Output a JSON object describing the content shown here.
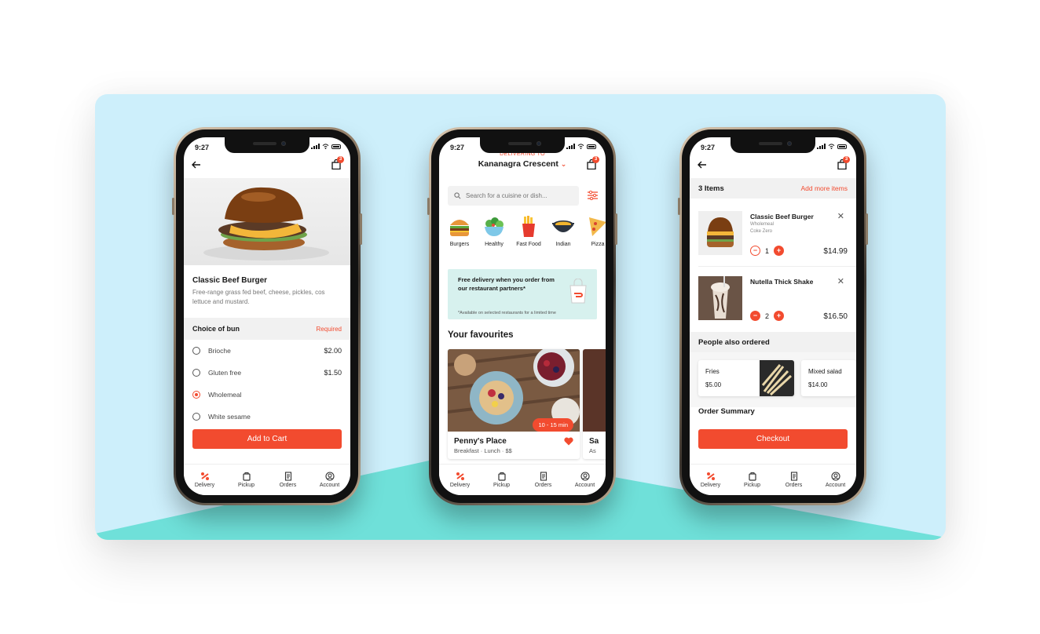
{
  "status_time": "9:27",
  "cart_count": "3",
  "tabs": [
    {
      "label": "Delivery",
      "icon": "delivery-icon"
    },
    {
      "label": "Pickup",
      "icon": "pickup-bag-icon"
    },
    {
      "label": "Orders",
      "icon": "receipt-icon"
    },
    {
      "label": "Account",
      "icon": "account-icon"
    }
  ],
  "colors": {
    "accent": "#f24b2f",
    "background": "#cdeffb",
    "floor": "#6fe0d9",
    "promo": "#d7f1ee"
  },
  "product": {
    "title": "Classic Beef Burger",
    "description": "Free-range grass fed beef, cheese, pickles, cos lettuce and mustard.",
    "section_title": "Choice of bun",
    "section_required": "Required",
    "options": [
      {
        "label": "Brioche",
        "price": "$2.00",
        "selected": false
      },
      {
        "label": "Gluten free",
        "price": "$1.50",
        "selected": false
      },
      {
        "label": "Wholemeal",
        "price": "",
        "selected": true
      },
      {
        "label": "White sesame",
        "price": "",
        "selected": false
      }
    ],
    "add_to_cart": "Add to Cart"
  },
  "home": {
    "delivering_to": "DELIVERING TO",
    "address": "Kananagra Crescent",
    "search_placeholder": "Search for a cuisine or dish...",
    "categories": [
      "Burgers",
      "Healthy",
      "Fast Food",
      "Indian",
      "Pizza"
    ],
    "promo_title": "Free delivery when you order from our restaurant partners*",
    "promo_note": "*Available on selected restaurants for a limited time",
    "favourites_title": "Your favourites",
    "card": {
      "name": "Penny's Place",
      "tags": "Breakfast · Lunch · $$",
      "eta": "10 - 15 min"
    },
    "card2": {
      "name": "Sa",
      "tags": "As"
    }
  },
  "cart": {
    "items_count": "3 Items",
    "add_more": "Add more items",
    "items": [
      {
        "name": "Classic Beef Burger",
        "mods": [
          "Wholemeal",
          "Coke Zero"
        ],
        "qty": "1",
        "price": "$14.99"
      },
      {
        "name": "Nutella Thick Shake",
        "mods": [],
        "qty": "2",
        "price": "$16.50"
      }
    ],
    "people_also_ordered": "People also ordered",
    "suggestions": [
      {
        "name": "Fries",
        "price": "$5.00"
      },
      {
        "name": "Mixed salad",
        "price": "$14.00"
      }
    ],
    "order_summary": "Order Summary",
    "checkout": "Checkout"
  }
}
